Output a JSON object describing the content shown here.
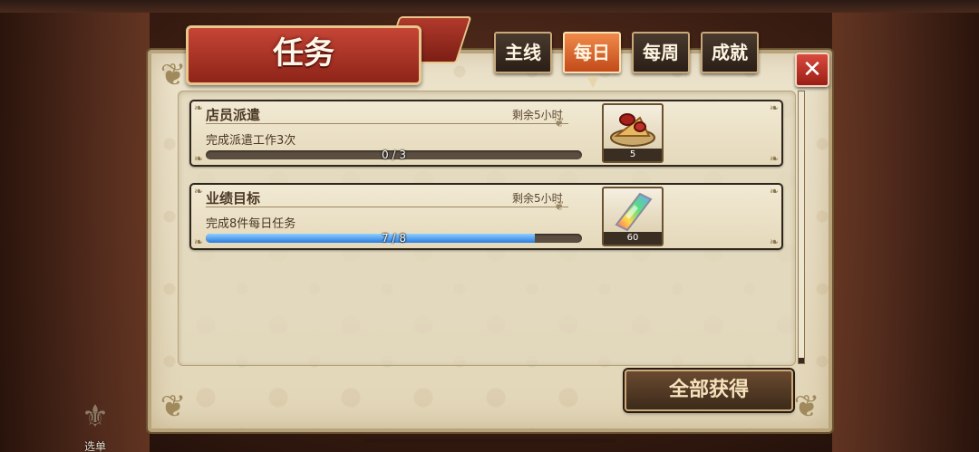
{
  "header": {
    "title": "任务"
  },
  "tabs": [
    {
      "label": "主线",
      "active": false
    },
    {
      "label": "每日",
      "active": true
    },
    {
      "label": "每周",
      "active": false
    },
    {
      "label": "成就",
      "active": false
    }
  ],
  "close_icon": "close-x-icon",
  "tasks": [
    {
      "title": "店员派遣",
      "time_left": "剩余5小时",
      "description": "完成派遣工作3次",
      "progress_text": "0 / 3",
      "progress_current": 0,
      "progress_total": 3,
      "reward_icon": "cooking-dish-icon",
      "reward_count": "5"
    },
    {
      "title": "业绩目标",
      "time_left": "剩余5小时",
      "description": "完成8件每日任务",
      "progress_text": "7 / 8",
      "progress_current": 7,
      "progress_total": 8,
      "reward_icon": "rainbow-crystal-icon",
      "reward_count": "60"
    }
  ],
  "collect_all_label": "全部获得",
  "menu": {
    "label": "选单",
    "icon": "fleur-de-lis-icon"
  },
  "colors": {
    "banner_red": "#b13a2c",
    "active_tab_orange": "#e0763a",
    "progress_blue": "#2a7be0",
    "parchment": "#e8ddc4"
  }
}
